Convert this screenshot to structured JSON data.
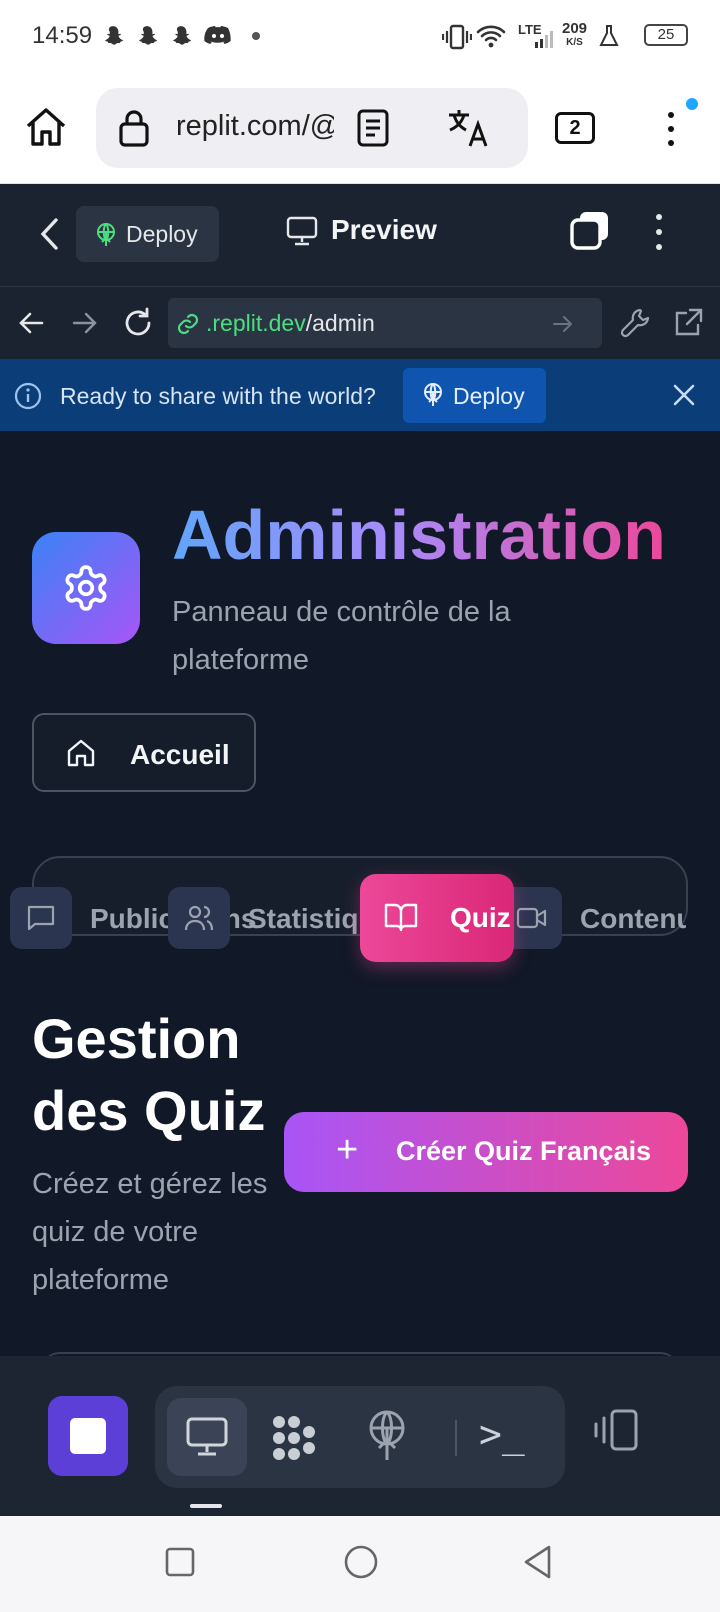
{
  "status_bar": {
    "time": "14:59",
    "network": "LTE",
    "speed_value": "209",
    "speed_unit": "K/S",
    "battery": "25",
    "icons": [
      "snapchat-icon",
      "snapchat-icon",
      "snapchat-icon",
      "discord-icon",
      "dot-icon",
      "vibrate-icon",
      "wifi-icon",
      "signal-icon",
      "flask-icon",
      "battery-icon"
    ]
  },
  "browser": {
    "url": "replit.com/@",
    "tab_count": "2",
    "icons": [
      "home-icon",
      "lock-icon",
      "reader-mode-icon",
      "translate-icon",
      "menu-icon"
    ],
    "notification_color": "#1ea7fd"
  },
  "replit_header": {
    "deploy_label": "Deploy",
    "preview_label": "Preview"
  },
  "address_bar": {
    "domain": ".replit.dev",
    "path": "/admin"
  },
  "banner": {
    "message": "Ready to share with the world?",
    "deploy_label": "Deploy"
  },
  "page": {
    "title": "Administration",
    "subtitle": "Panneau de contrôle de la plateforme",
    "home_button": "Accueil",
    "tabs": [
      {
        "label": "Publications",
        "icon": "message-square-icon"
      },
      {
        "label": "Statistiques",
        "icon": "users-icon"
      },
      {
        "label": "Quiz",
        "icon": "book-open-icon",
        "active": true
      },
      {
        "label": "Contenu",
        "icon": "video-icon"
      }
    ],
    "section_title": "Gestion des Quiz",
    "section_desc": "Créez et gérez les quiz de votre plateforme",
    "create_button": "Créer Quiz Français",
    "create_plus": "+"
  },
  "dock": {
    "terminal_glyph": ">_",
    "icons": [
      "stop-icon",
      "preview-icon",
      "workspace-icon",
      "deploy-icon",
      "shell-icon",
      "device-icon"
    ]
  },
  "colors": {
    "accent_pink": "#ec4899",
    "accent_purple": "#a855f7",
    "accent_blue": "#3b82f6",
    "page_bg": "#111827",
    "banner_bg": "#0b3d78"
  }
}
